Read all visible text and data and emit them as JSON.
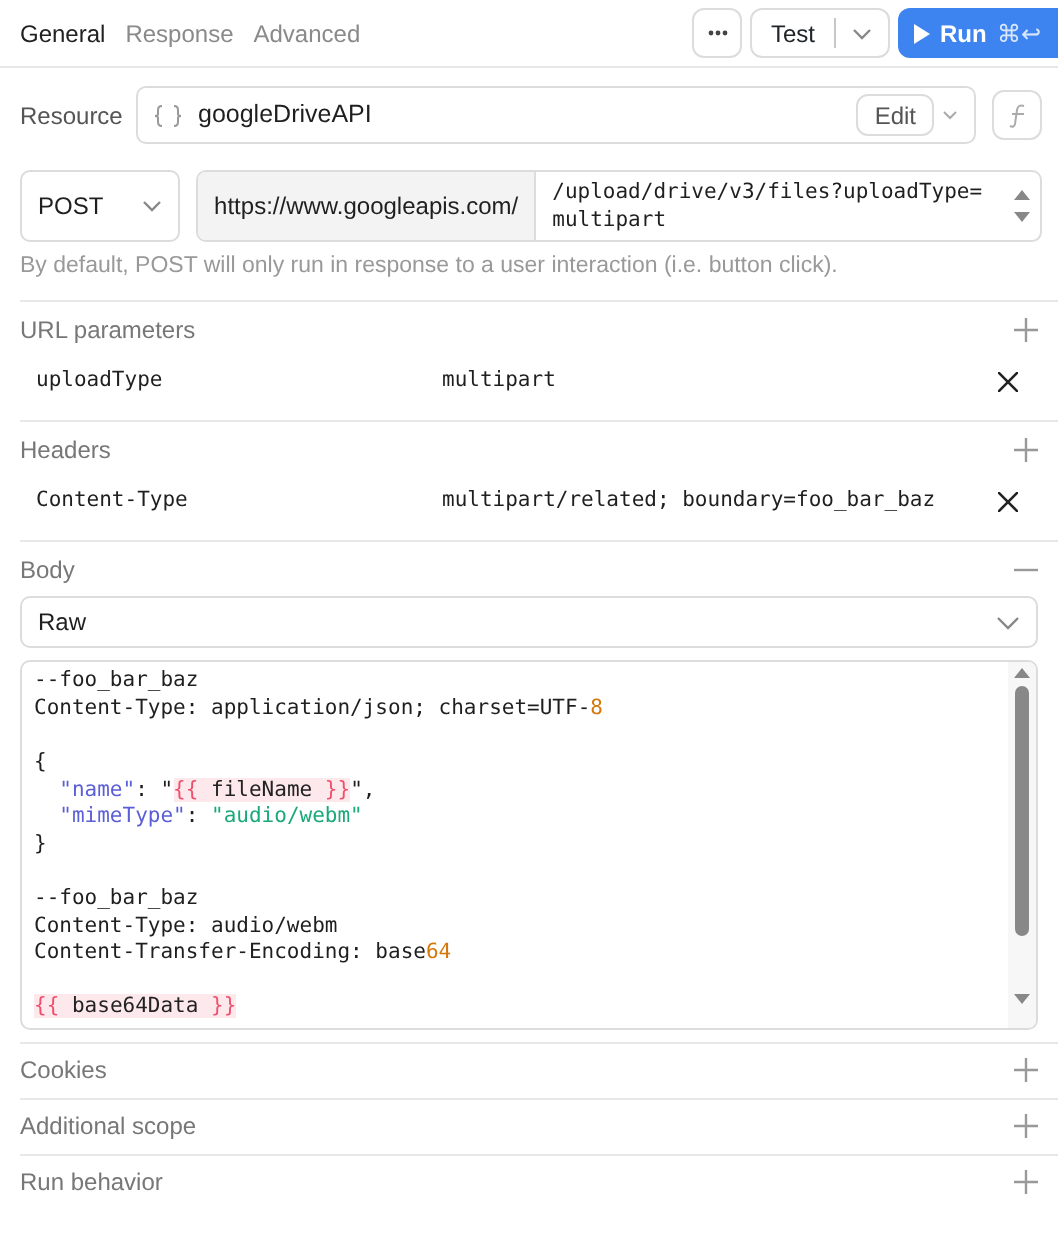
{
  "tabs": [
    {
      "label": "General",
      "selected": true
    },
    {
      "label": "Response",
      "selected": false
    },
    {
      "label": "Advanced",
      "selected": false
    }
  ],
  "toolbar": {
    "test_label": "Test",
    "run_label": "Run",
    "run_shortcut": "⌘↩"
  },
  "resource": {
    "label": "Resource",
    "name": "googleDriveAPI",
    "edit_label": "Edit"
  },
  "request": {
    "method": "POST",
    "base_url": "https://www.googleapis.com/",
    "path": "/upload/drive/v3/files?uploadType=multipart",
    "hint": "By default, POST will only run in response to a user interaction (i.e. button click)."
  },
  "sections": [
    {
      "title": "URL parameters",
      "kind": "pairs",
      "rows": [
        {
          "key": "uploadType",
          "value": "multipart"
        }
      ]
    },
    {
      "title": "Headers",
      "kind": "pairs",
      "rows": [
        {
          "key": "Content-Type",
          "value": "multipart/related; boundary=foo_bar_baz"
        }
      ]
    },
    {
      "title": "Body",
      "kind": "body",
      "expanded": true,
      "body_type": "Raw",
      "lines": [
        {
          "gap_before": false,
          "indent": false,
          "tokens": [
            {
              "text": "--foo_bar_baz",
              "kind": "plain"
            }
          ]
        },
        {
          "gap_before": false,
          "indent": false,
          "tokens": [
            {
              "text": "Content-Type: application/json; charset=UTF-",
              "kind": "plain"
            },
            {
              "text": "8",
              "kind": "number"
            }
          ]
        },
        {
          "gap_before": true,
          "indent": false,
          "tokens": [
            {
              "text": "{",
              "kind": "plain"
            }
          ]
        },
        {
          "gap_before": false,
          "indent": true,
          "tokens": [
            {
              "text": "\"name\"",
              "kind": "key"
            },
            {
              "text": ": \"",
              "kind": "plain"
            },
            {
              "text": "{{",
              "kind": "brace"
            },
            {
              "text": " fileName ",
              "kind": "var"
            },
            {
              "text": "}}",
              "kind": "brace"
            },
            {
              "text": "\",",
              "kind": "plain"
            }
          ]
        },
        {
          "gap_before": false,
          "indent": true,
          "tokens": [
            {
              "text": "\"mimeType\"",
              "kind": "key"
            },
            {
              "text": ": ",
              "kind": "plain"
            },
            {
              "text": "\"audio/webm\"",
              "kind": "string"
            }
          ]
        },
        {
          "gap_before": false,
          "indent": false,
          "tokens": [
            {
              "text": "}",
              "kind": "plain"
            }
          ]
        },
        {
          "gap_before": true,
          "indent": false,
          "tokens": [
            {
              "text": "--foo_bar_baz",
              "kind": "plain"
            }
          ]
        },
        {
          "gap_before": false,
          "indent": false,
          "tokens": [
            {
              "text": "Content-Type: audio/webm",
              "kind": "plain"
            }
          ]
        },
        {
          "gap_before": false,
          "indent": false,
          "tokens": [
            {
              "text": "Content-Transfer-Encoding: base",
              "kind": "plain"
            },
            {
              "text": "64",
              "kind": "number"
            }
          ]
        },
        {
          "gap_before": true,
          "indent": false,
          "tokens": [
            {
              "text": "{{",
              "kind": "brace"
            },
            {
              "text": " base64Data ",
              "kind": "var"
            },
            {
              "text": "}}",
              "kind": "brace"
            }
          ]
        }
      ]
    },
    {
      "title": "Cookies",
      "kind": "pairs"
    },
    {
      "title": "Additional scope",
      "kind": "pairs"
    },
    {
      "title": "Run behavior",
      "kind": "pairs"
    }
  ]
}
